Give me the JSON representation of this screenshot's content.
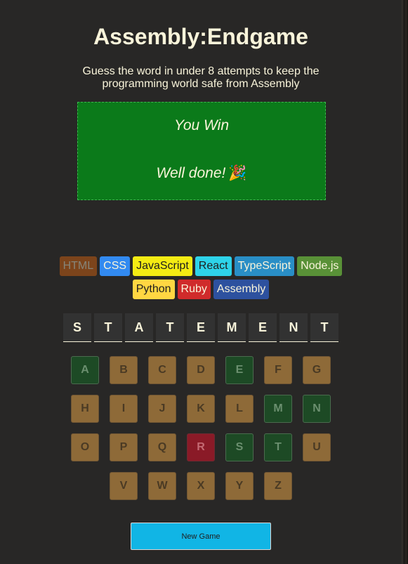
{
  "header": {
    "title": "Assembly:Endgame",
    "subtitle": "Guess the word in under 8 attempts to keep the programming world safe from Assembly"
  },
  "status": {
    "title": "You Win",
    "message": "Well done!",
    "emoji": "🎉",
    "background": "#0b7a1a"
  },
  "languages": [
    {
      "name": "HTML",
      "bg": "#e2680f",
      "color": "#f9f4da",
      "lost": true
    },
    {
      "name": "CSS",
      "bg": "#328af1",
      "color": "#f9f4da",
      "lost": false
    },
    {
      "name": "JavaScript",
      "bg": "#f4eb13",
      "color": "#1e1e1e",
      "lost": false
    },
    {
      "name": "React",
      "bg": "#2ed3e9",
      "color": "#1e1e1e",
      "lost": false
    },
    {
      "name": "TypeScript",
      "bg": "#298ec6",
      "color": "#f9f4da",
      "lost": false
    },
    {
      "name": "Node.js",
      "bg": "#599137",
      "color": "#f9f4da",
      "lost": false
    },
    {
      "name": "Python",
      "bg": "#ffd742",
      "color": "#1e1e1e",
      "lost": false
    },
    {
      "name": "Ruby",
      "bg": "#d02b2b",
      "color": "#f9f4da",
      "lost": false
    },
    {
      "name": "Assembly",
      "bg": "#2d519f",
      "color": "#f9f4da",
      "lost": false
    }
  ],
  "word": [
    "S",
    "T",
    "A",
    "T",
    "E",
    "M",
    "E",
    "N",
    "T"
  ],
  "keyboard": [
    {
      "letter": "A",
      "state": "correct"
    },
    {
      "letter": "B",
      "state": "unused"
    },
    {
      "letter": "C",
      "state": "unused"
    },
    {
      "letter": "D",
      "state": "unused"
    },
    {
      "letter": "E",
      "state": "correct"
    },
    {
      "letter": "F",
      "state": "unused"
    },
    {
      "letter": "G",
      "state": "unused"
    },
    {
      "letter": "H",
      "state": "unused"
    },
    {
      "letter": "I",
      "state": "unused"
    },
    {
      "letter": "J",
      "state": "unused"
    },
    {
      "letter": "K",
      "state": "unused"
    },
    {
      "letter": "L",
      "state": "unused"
    },
    {
      "letter": "M",
      "state": "correct"
    },
    {
      "letter": "N",
      "state": "correct"
    },
    {
      "letter": "O",
      "state": "unused"
    },
    {
      "letter": "P",
      "state": "unused"
    },
    {
      "letter": "Q",
      "state": "unused"
    },
    {
      "letter": "R",
      "state": "wrong"
    },
    {
      "letter": "S",
      "state": "correct"
    },
    {
      "letter": "T",
      "state": "correct"
    },
    {
      "letter": "U",
      "state": "unused"
    },
    {
      "letter": "V",
      "state": "unused"
    },
    {
      "letter": "W",
      "state": "unused"
    },
    {
      "letter": "X",
      "state": "unused"
    },
    {
      "letter": "Y",
      "state": "unused"
    },
    {
      "letter": "Z",
      "state": "unused"
    }
  ],
  "new_game_label": "New Game"
}
